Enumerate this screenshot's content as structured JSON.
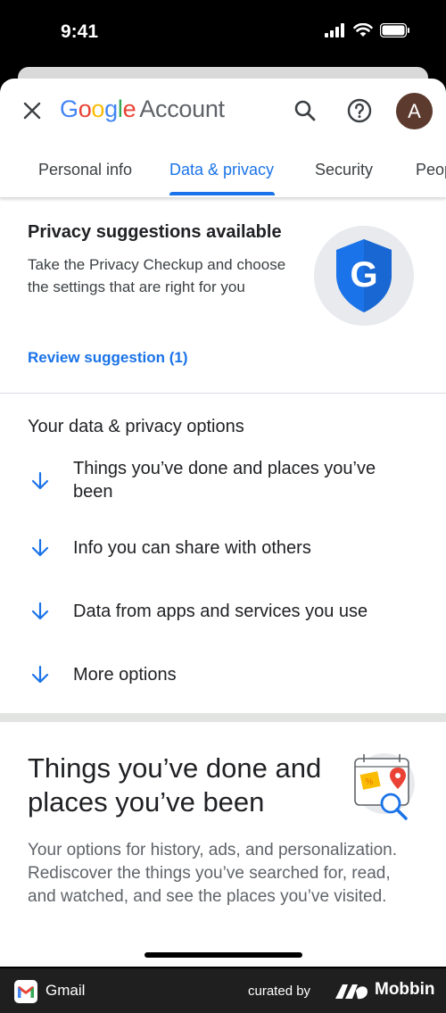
{
  "status_bar": {
    "time": "9:41"
  },
  "header": {
    "logo_letters": [
      "G",
      "o",
      "o",
      "g",
      "l",
      "e"
    ],
    "logo_suffix": "Account",
    "avatar_initial": "A"
  },
  "tabs": [
    {
      "label": "Personal info",
      "active": false
    },
    {
      "label": "Data & privacy",
      "active": true
    },
    {
      "label": "Security",
      "active": false
    },
    {
      "label": "People",
      "active": false
    }
  ],
  "privacy_card": {
    "title": "Privacy suggestions available",
    "description": "Take the Privacy Checkup and choose the settings that are right for you",
    "link": "Review suggestion (1)",
    "badge_letter": "G"
  },
  "options": {
    "title": "Your data & privacy options",
    "items": [
      {
        "label": "Things you’ve done and places you’ve been"
      },
      {
        "label": "Info you can share with others"
      },
      {
        "label": "Data from apps and services you use"
      },
      {
        "label": "More options"
      }
    ]
  },
  "things_section": {
    "title": "Things you’ve done and places you’ve been",
    "description": "Your options for history, ads, and personalization. Rediscover the things you’ve searched for, read, and watched, and see the places you’ve visited."
  },
  "footer": {
    "app_name": "Gmail",
    "curated_by": "curated by",
    "brand": "Mobbin"
  },
  "colors": {
    "accent": "#1a73e8",
    "avatar": "#5d3a2e",
    "shield": "#1a73e8"
  }
}
